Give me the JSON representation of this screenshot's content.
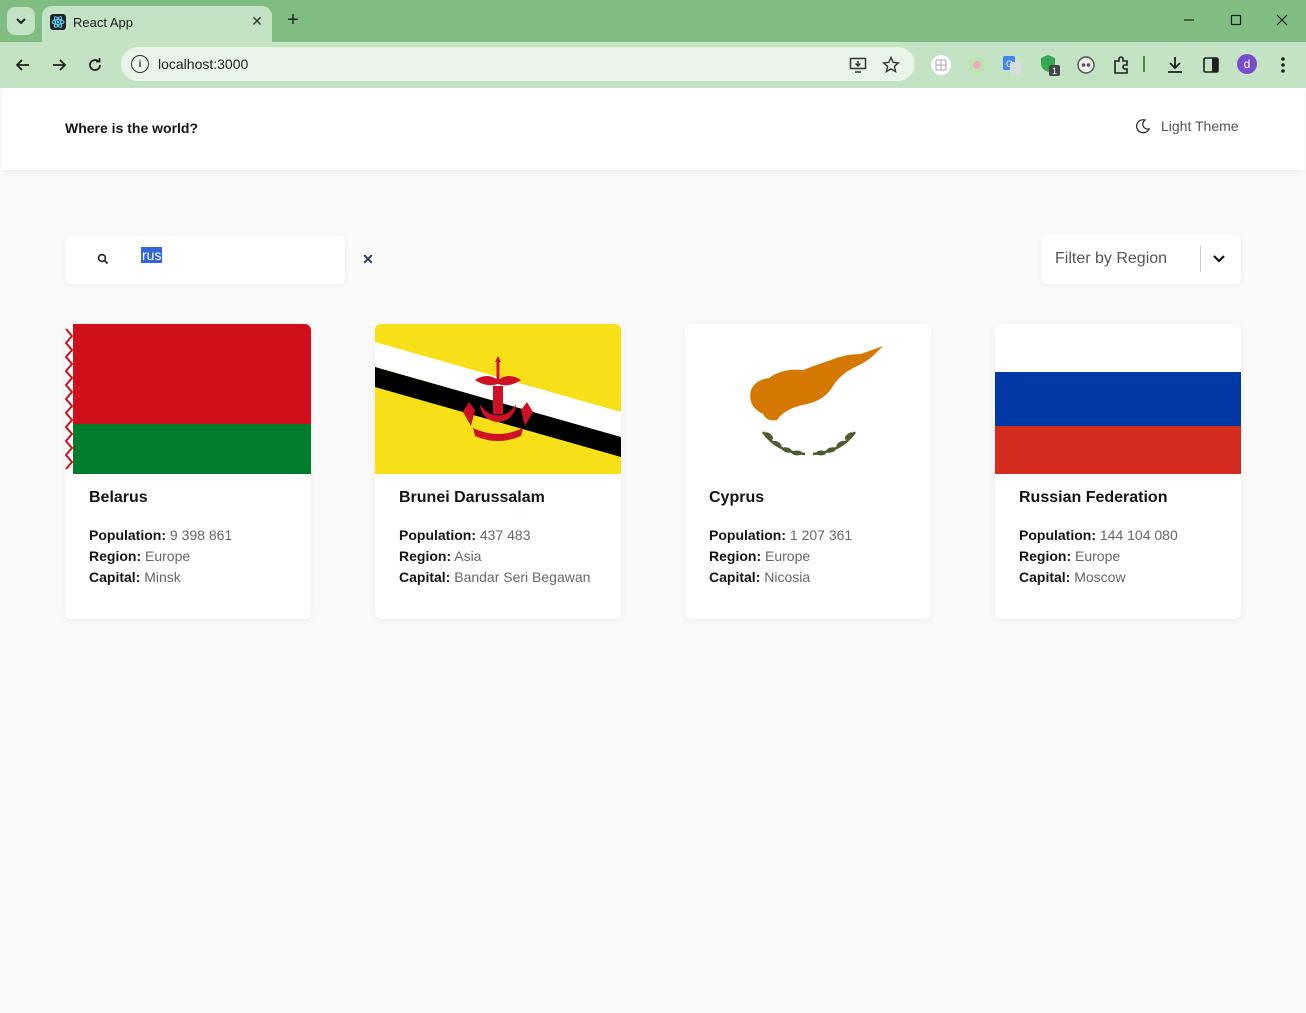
{
  "browser": {
    "tab_title": "React App",
    "url": "localhost:3000",
    "extension_badge": "1",
    "avatar_letter": "d"
  },
  "header": {
    "title": "Where is the world?",
    "theme_label": "Light Theme"
  },
  "search": {
    "value": "rus",
    "placeholder": ""
  },
  "filter": {
    "label": "Filter by Region"
  },
  "labels": {
    "population": "Population:",
    "region": "Region:",
    "capital": "Capital:"
  },
  "countries": [
    {
      "name": "Belarus",
      "population": "9 398 861",
      "region": "Europe",
      "capital": "Minsk"
    },
    {
      "name": "Brunei Darussalam",
      "population": "437 483",
      "region": "Asia",
      "capital": "Bandar Seri Begawan"
    },
    {
      "name": "Cyprus",
      "population": "1 207 361",
      "region": "Europe",
      "capital": "Nicosia"
    },
    {
      "name": "Russian Federation",
      "population": "144 104 080",
      "region": "Europe",
      "capital": "Moscow"
    }
  ],
  "colors": {
    "browser_frame": "#80bd80",
    "browser_toolbar": "#c4e3c4",
    "page_bg": "#fafafa",
    "text_dark": "#111517",
    "selection": "#3367d6"
  }
}
